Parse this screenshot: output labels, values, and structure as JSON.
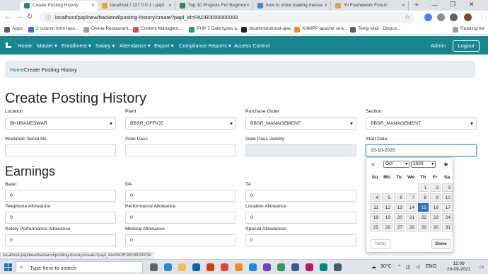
{
  "browser": {
    "tabs": [
      {
        "title": "Create Posting History",
        "active": true,
        "icon": "app-favicon",
        "color": "#17868e"
      },
      {
        "title": "localhost / 127.0.0.1 / papl",
        "active": false,
        "icon": "phpmyadmin-icon",
        "color": "#f0a030"
      },
      {
        "title": "Top 10 Projects For Beginne",
        "active": false,
        "icon": "geeks-icon",
        "color": "#2f8d46"
      },
      {
        "title": "how to show loading messa",
        "active": false,
        "icon": "google-icon",
        "color": "#4285f4"
      },
      {
        "title": "Yii Framework Forum",
        "active": false,
        "icon": "yii-icon",
        "color": "#d6a84a"
      }
    ],
    "url": "localhost/paplnew/backend/posting-history/create?papl_id=PADR0000000003",
    "reading_list": "Reading list",
    "bookmarks": [
      {
        "label": "Apps",
        "icon": "apps-grid-icon",
        "color": "#5f6368"
      },
      {
        "label": "2 column form layo...",
        "icon": "bookmark-icon",
        "color": "#3b6fd6"
      },
      {
        "label": "Online Restaurant...",
        "icon": "doc-icon",
        "color": "#9aa0a6"
      },
      {
        "label": "Content Managem...",
        "icon": "bookmark-icon",
        "color": "#e34b4b"
      },
      {
        "label": "PHP 7 Data types a...",
        "icon": "w3-icon",
        "color": "#2b9f5e"
      },
      {
        "label": "Studentstutorial-ajax",
        "icon": "bookmark-icon",
        "color": "#222"
      },
      {
        "label": "XAMPP apache serv...",
        "icon": "xampp-icon",
        "color": "#f08a24"
      },
      {
        "label": "Temp Mail - Dispos...",
        "icon": "mail-icon",
        "color": "#5f6368"
      }
    ]
  },
  "nav": {
    "items": [
      "Home",
      "Master ▾",
      "Enrollment ▾",
      "Salary ▾",
      "Attendance ▾",
      "Export ▾",
      "Compliance Reports ▾",
      "Access Control"
    ],
    "admin": "Admin",
    "logout": "Logout",
    "color": "#17868e"
  },
  "breadcrumb": {
    "home": "Home",
    "current": "Create Posting History"
  },
  "page_title": "Create Posting History",
  "fields": {
    "location": {
      "label": "Location",
      "value": "BHUBANESWAR"
    },
    "plant": {
      "label": "Plant",
      "value": "BBSR_OFFICE"
    },
    "purchase_order": {
      "label": "Purchase Order",
      "value": "BBSR_MANAGEMENT"
    },
    "section": {
      "label": "Section",
      "value": "BBSR_MANAGEMENT"
    },
    "workman_serial": {
      "label": "Workman Serial No",
      "value": ""
    },
    "gate_pass": {
      "label": "Gate Pass",
      "value": ""
    },
    "gate_pass_validity": {
      "label": "Gate Pass Validity",
      "value": ""
    },
    "start_date": {
      "label": "Start Date",
      "value": "15-10-2020"
    }
  },
  "earnings": {
    "heading": "Earnings",
    "basic": {
      "label": "Basic",
      "value": "0"
    },
    "da": {
      "label": "DA",
      "value": "0"
    },
    "ta": {
      "label": "TA",
      "value": "0"
    },
    "telephone": {
      "label": "Telephone Allowance",
      "value": "0"
    },
    "performance": {
      "label": "Performance Allowance",
      "value": "0"
    },
    "location_allowance": {
      "label": "Location Allowance",
      "value": "0"
    },
    "safety": {
      "label": "Safety Performance Allowance",
      "value": "0"
    },
    "medical": {
      "label": "Medical Allowance",
      "value": "0"
    },
    "special": {
      "label": "Special Allowances",
      "value": "0"
    }
  },
  "datepicker": {
    "month": "Oct",
    "year": "2020",
    "weekdays": [
      "Su",
      "Mo",
      "Tu",
      "We",
      "Th",
      "Fr",
      "Sa"
    ],
    "days": [
      "1",
      "2",
      "3",
      "4",
      "5",
      "6",
      "7",
      "8",
      "9",
      "10",
      "11",
      "12",
      "13",
      "14",
      "15",
      "16",
      "17",
      "18",
      "19",
      "20",
      "21",
      "22",
      "23",
      "24",
      "25",
      "26",
      "27",
      "28",
      "29",
      "30",
      "31"
    ],
    "first_weekday": 4,
    "selected": "15",
    "today_label": "Today",
    "done_label": "Done",
    "selected_color": "#2b74d6"
  },
  "status_url": "localhost/paplnew/backend/posting-history/create?papl_id=PADR0000000003#",
  "taskbar": {
    "search_placeholder": "Type here to search",
    "weather": "30°C",
    "language": "ENG",
    "time": "12:09",
    "date": "20-09-2021"
  }
}
